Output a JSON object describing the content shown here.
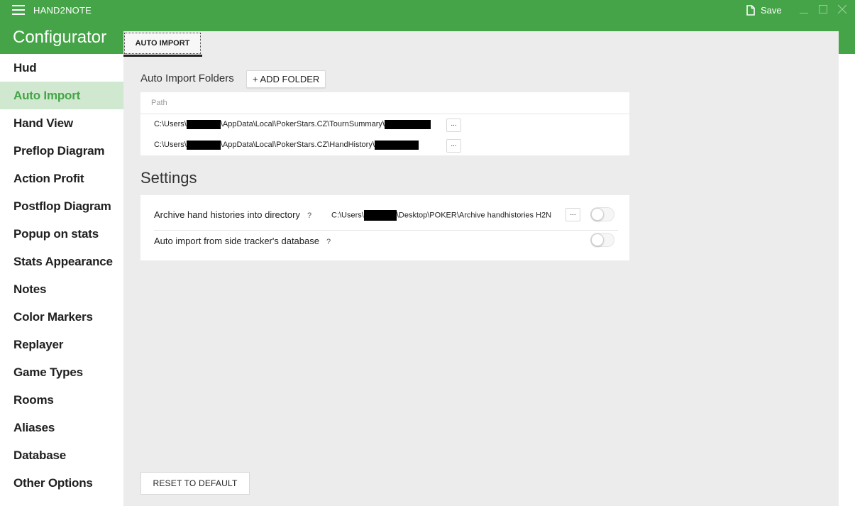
{
  "titlebar": {
    "app_title": "HAND2NOTE",
    "save_label": "Save"
  },
  "sidebar": {
    "title": "Configurator",
    "items": [
      {
        "label": "Hud"
      },
      {
        "label": "Auto Import",
        "active": true
      },
      {
        "label": "Hand View"
      },
      {
        "label": "Preflop Diagram"
      },
      {
        "label": "Action Profit"
      },
      {
        "label": "Postflop Diagram"
      },
      {
        "label": "Popup on stats"
      },
      {
        "label": "Stats Appearance"
      },
      {
        "label": "Notes"
      },
      {
        "label": "Color Markers"
      },
      {
        "label": "Replayer"
      },
      {
        "label": "Game Types"
      },
      {
        "label": "Rooms"
      },
      {
        "label": "Aliases"
      },
      {
        "label": "Database"
      },
      {
        "label": "Other Options"
      }
    ]
  },
  "main": {
    "tab_label": "AUTO IMPORT",
    "folders": {
      "section_label": "Auto Import Folders",
      "add_button_label": "+ ADD FOLDER",
      "column_header": "Path",
      "rows": [
        {
          "prefix": "C:\\Users\\",
          "middle": "\\AppData\\Local\\PokerStars.CZ\\TournSummary\\",
          "browse_label": "..."
        },
        {
          "prefix": "C:\\Users\\",
          "middle": "\\AppData\\Local\\PokerStars.CZ\\HandHistory\\",
          "browse_label": "..."
        }
      ]
    },
    "settings": {
      "title": "Settings",
      "archive": {
        "label": "Archive hand histories into directory",
        "help": "?",
        "path_prefix": "C:\\Users\\",
        "path_suffix": "\\Desktop\\POKER\\Archive handhistories H2N",
        "browse_label": "...",
        "enabled": false
      },
      "side_tracker": {
        "label": "Auto import from side tracker's database",
        "help": "?",
        "enabled": false
      }
    },
    "reset_label": "RESET TO DEFAULT"
  },
  "colors": {
    "accent": "#45a447",
    "active_bg": "#cfe8cf",
    "background": "#ececec"
  }
}
